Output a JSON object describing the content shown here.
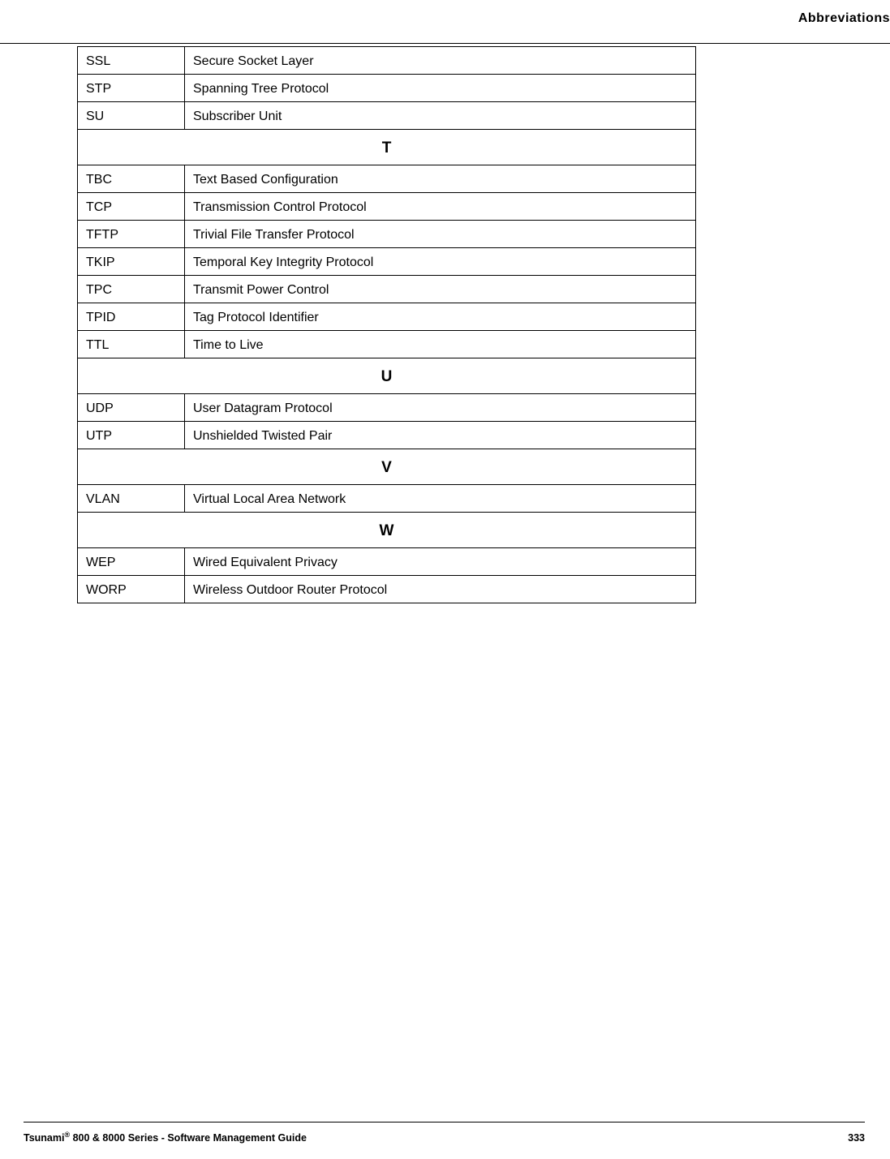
{
  "header": {
    "title": "Abbreviations"
  },
  "table": {
    "rows": [
      {
        "type": "entry",
        "abbr": "SSL",
        "def": "Secure Socket Layer"
      },
      {
        "type": "entry",
        "abbr": "STP",
        "def": "Spanning Tree Protocol"
      },
      {
        "type": "entry",
        "abbr": "SU",
        "def": "Subscriber Unit"
      },
      {
        "type": "section",
        "letter": "T"
      },
      {
        "type": "entry",
        "abbr": "TBC",
        "def": "Text Based Configuration"
      },
      {
        "type": "entry",
        "abbr": "TCP",
        "def": "Transmission Control Protocol"
      },
      {
        "type": "entry",
        "abbr": "TFTP",
        "def": "Trivial File Transfer Protocol"
      },
      {
        "type": "entry",
        "abbr": "TKIP",
        "def": "Temporal Key Integrity Protocol"
      },
      {
        "type": "entry",
        "abbr": "TPC",
        "def": "Transmit Power Control"
      },
      {
        "type": "entry",
        "abbr": "TPID",
        "def": "Tag Protocol Identifier"
      },
      {
        "type": "entry",
        "abbr": "TTL",
        "def": "Time to Live"
      },
      {
        "type": "section",
        "letter": "U"
      },
      {
        "type": "entry",
        "abbr": "UDP",
        "def": "User Datagram Protocol"
      },
      {
        "type": "entry",
        "abbr": "UTP",
        "def": "Unshielded Twisted Pair"
      },
      {
        "type": "section",
        "letter": "V"
      },
      {
        "type": "entry",
        "abbr": "VLAN",
        "def": "Virtual Local Area Network"
      },
      {
        "type": "section",
        "letter": "W"
      },
      {
        "type": "entry",
        "abbr": "WEP",
        "def": "Wired Equivalent Privacy"
      },
      {
        "type": "entry",
        "abbr": "WORP",
        "def": "Wireless Outdoor Router Protocol"
      }
    ]
  },
  "footer": {
    "product": "Tsunami",
    "reg": "®",
    "series": " 800 & 8000 Series - Software Management Guide",
    "page": "333"
  }
}
